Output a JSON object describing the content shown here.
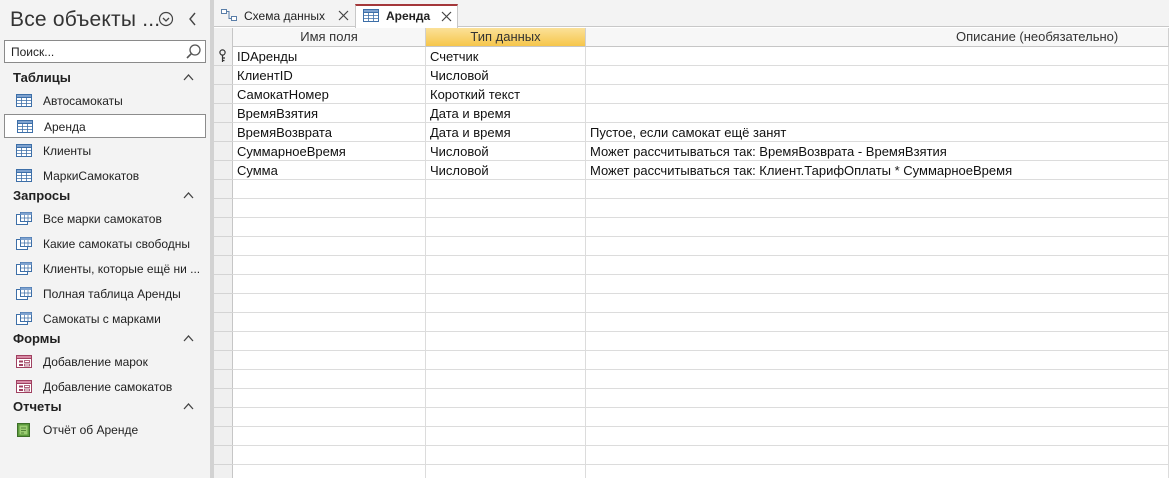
{
  "nav": {
    "title": "Все объекты ...",
    "search_placeholder": "Поиск...",
    "groups": [
      {
        "label": "Таблицы",
        "items": [
          {
            "label": "Автосамокаты",
            "icon": "table-icon"
          },
          {
            "label": "Аренда",
            "icon": "table-icon",
            "selected": true
          },
          {
            "label": "Клиенты",
            "icon": "table-icon"
          },
          {
            "label": "МаркиСамокатов",
            "icon": "table-icon"
          }
        ]
      },
      {
        "label": "Запросы",
        "items": [
          {
            "label": "Все марки самокатов",
            "icon": "query-icon"
          },
          {
            "label": "Какие самокаты свободны",
            "icon": "query-icon"
          },
          {
            "label": "Клиенты, которые ещё ни ...",
            "icon": "query-icon"
          },
          {
            "label": "Полная таблица Аренды",
            "icon": "query-icon"
          },
          {
            "label": "Самокаты с марками",
            "icon": "query-icon"
          }
        ]
      },
      {
        "label": "Формы",
        "items": [
          {
            "label": "Добавление марок",
            "icon": "form-icon"
          },
          {
            "label": "Добавление самокатов",
            "icon": "form-icon"
          }
        ]
      },
      {
        "label": "Отчеты",
        "items": [
          {
            "label": "Отчёт об Аренде",
            "icon": "report-icon"
          }
        ]
      }
    ]
  },
  "tabs": [
    {
      "label": "Схема данных",
      "icon": "relationships-icon",
      "active": false
    },
    {
      "label": "Аренда",
      "icon": "table-icon",
      "active": true
    }
  ],
  "grid": {
    "headers": [
      "Имя поля",
      "Тип данных",
      "Описание (необязательно)"
    ],
    "rows": [
      {
        "name": "IDАренды",
        "type": "Счетчик",
        "desc": "",
        "primary_key": true
      },
      {
        "name": "КлиентID",
        "type": "Числовой",
        "desc": ""
      },
      {
        "name": "СамокатНомер",
        "type": "Короткий текст",
        "desc": ""
      },
      {
        "name": "ВремяВзятия",
        "type": "Дата и время",
        "desc": ""
      },
      {
        "name": "ВремяВозврата",
        "type": "Дата и время",
        "desc": "Пустое, если самокат ещё занят"
      },
      {
        "name": "СуммарноеВремя",
        "type": "Числовой",
        "desc": "Может рассчитываться так: ВремяВозврата - ВремяВзятия"
      },
      {
        "name": "Сумма",
        "type": "Числовой",
        "desc": "Может рассчитываться так: Клиент.ТарифОплаты * СуммарноеВремя"
      }
    ]
  },
  "colors": {
    "accent": "#a4373a",
    "header_active": "#f6c64b"
  }
}
